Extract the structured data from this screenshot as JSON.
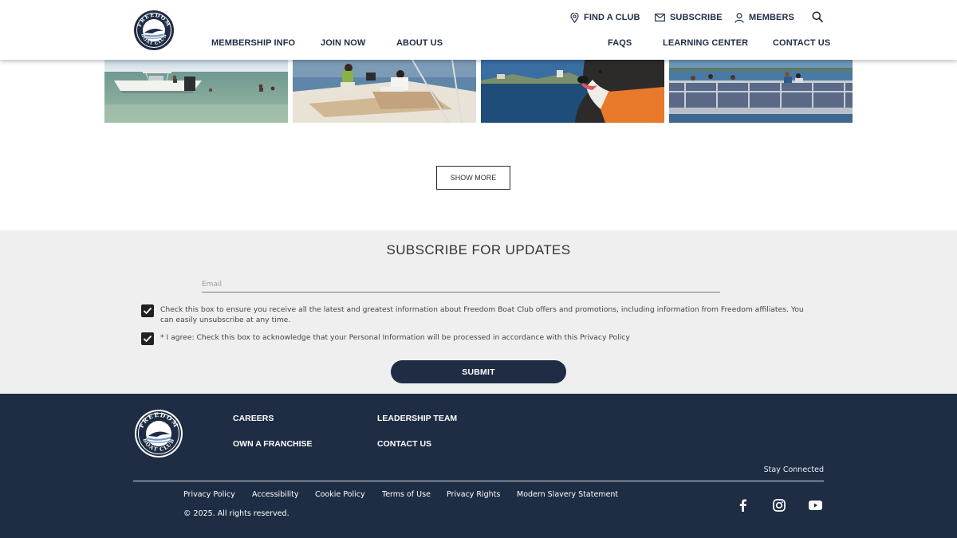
{
  "header": {
    "logo_text": "FREEDOM BOAT CLUB",
    "utility": {
      "find_club": "FIND A CLUB",
      "subscribe": "SUBSCRIBE",
      "members": "MEMBERS"
    },
    "nav": {
      "membership_info": "MEMBERSHIP INFO",
      "join_now": "JOIN NOW",
      "about_us": "ABOUT US",
      "faqs": "FAQS",
      "learning_center": "LEARNING CENTER",
      "contact_us": "CONTACT US"
    }
  },
  "gallery": {
    "show_more": "SHOW MORE"
  },
  "subscribe": {
    "title": "SUBSCRIBE FOR UPDATES",
    "email_placeholder": "Email",
    "email_value": "",
    "consent_offers": "Check this box to ensure you receive all the latest and greatest information about Freedom Boat Club offers and promotions, including information from Freedom affiliates.  You can easily unsubscribe at any time.",
    "consent_offers_checked": true,
    "consent_privacy": "* I agree: Check this box to acknowledge that your Personal Information will be processed in accordance with this Privacy Policy",
    "consent_privacy_checked": true,
    "submit": "SUBMIT"
  },
  "footer": {
    "links": {
      "careers": "CAREERS",
      "own_franchise": "OWN A FRANCHISE",
      "leadership_team": "LEADERSHIP TEAM",
      "contact_us": "CONTACT US"
    },
    "stay_connected": "Stay Connected",
    "legal": {
      "privacy_policy": "Privacy Policy",
      "accessibility": "Accessibility",
      "cookie_policy": "Cookie Policy",
      "terms_of_use": "Terms of Use",
      "privacy_rights": "Privacy Rights",
      "modern_slavery": "Modern Slavery Statement"
    },
    "copyright": "© 2025. All rights reserved.",
    "social_icons": [
      "facebook-icon",
      "instagram-icon",
      "youtube-icon"
    ]
  },
  "colors": {
    "navy": "#1e2d44",
    "subscribe_bg": "#efefef",
    "white": "#ffffff"
  }
}
